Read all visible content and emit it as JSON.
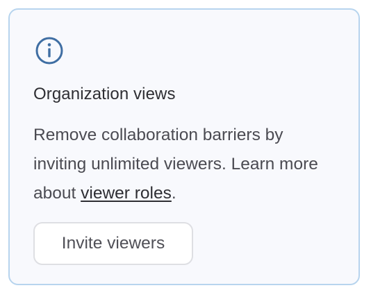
{
  "card": {
    "icon": "info-icon",
    "title": "Organization views",
    "description_before": "Remove collaboration barriers by inviting unlimited viewers. Learn more about ",
    "link_label": "viewer roles",
    "description_after": ".",
    "button_label": "Invite viewers"
  },
  "colors": {
    "accent": "#3f6ea3",
    "card_border": "#b7d4ee",
    "card_background": "#f8f9fd"
  }
}
